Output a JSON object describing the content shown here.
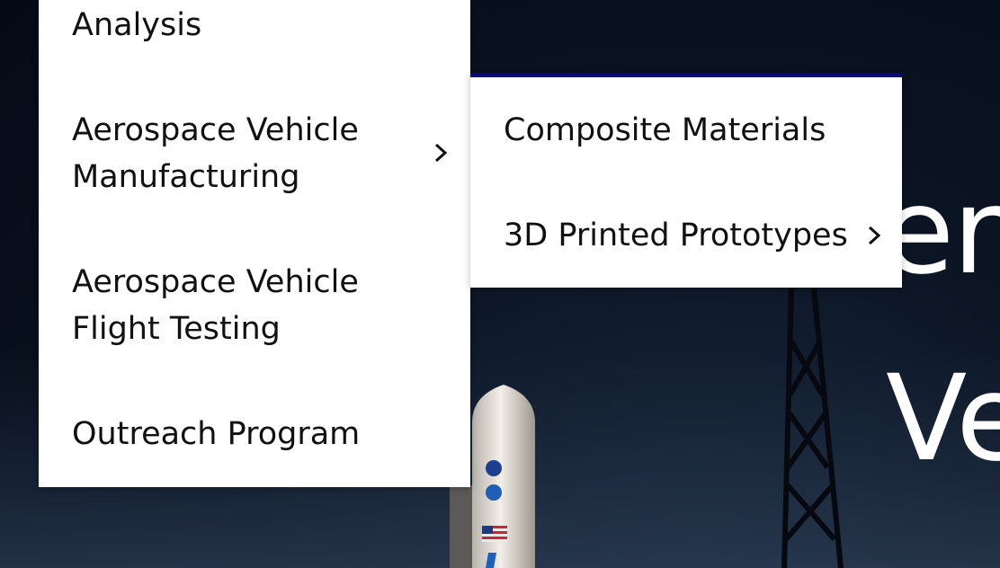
{
  "background": {
    "hero_line_1": "er",
    "hero_line_2": "Ve",
    "colors": {
      "sky": "#050a16",
      "rocket_body": "#efeae2",
      "tower": "#0a0f17"
    },
    "decal_icons": [
      "nasa-logo-icon",
      "agency-logo-icon",
      "us-flag-icon"
    ]
  },
  "main_menu": {
    "items": [
      {
        "label": "Analysis",
        "has_submenu": false
      },
      {
        "label": "Aerospace Vehicle Manufacturing",
        "has_submenu": true,
        "chevron_icon": "chevron-right-icon"
      },
      {
        "label": "Aerospace Vehicle Flight Testing",
        "has_submenu": false
      },
      {
        "label": "Outreach Program",
        "has_submenu": false
      }
    ]
  },
  "sub_menu": {
    "accent_color": "#0a0a7a",
    "items": [
      {
        "label": "Composite Materials",
        "has_submenu": false
      },
      {
        "label": "3D Printed Prototypes",
        "has_submenu": true,
        "chevron_icon": "chevron-right-icon"
      }
    ]
  }
}
